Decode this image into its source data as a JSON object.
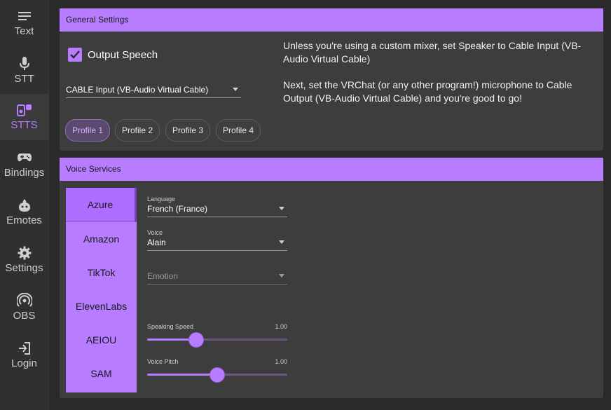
{
  "sidebar": {
    "items": [
      {
        "label": "Text",
        "icon": "menu-lines-icon"
      },
      {
        "label": "STT",
        "icon": "microphone-icon"
      },
      {
        "label": "STTS",
        "icon": "speaker-icon"
      },
      {
        "label": "Bindings",
        "icon": "gamepad-icon"
      },
      {
        "label": "Emotes",
        "icon": "emote-icon"
      },
      {
        "label": "Settings",
        "icon": "gear-icon"
      },
      {
        "label": "OBS",
        "icon": "broadcast-icon"
      },
      {
        "label": "Login",
        "icon": "login-icon"
      }
    ],
    "active": "STTS"
  },
  "general": {
    "title": "General Settings",
    "output_speech_label": "Output Speech",
    "output_speech_checked": true,
    "speaker_value": "CABLE Input (VB-Audio Virtual Cable)",
    "help_1": "Unless you're using a custom mixer, set Speaker to Cable Input (VB-Audio Virtual Cable)",
    "help_2": "Next, set the VRChat (or any other program!) microphone to Cable Output (VB-Audio Virtual Cable) and you're good to go!",
    "profiles": [
      "Profile 1",
      "Profile 2",
      "Profile 3",
      "Profile 4"
    ],
    "active_profile": "Profile 1"
  },
  "voice": {
    "title": "Voice Services",
    "services": [
      "Azure",
      "Amazon",
      "TikTok",
      "ElevenLabs",
      "AEIOU",
      "SAM"
    ],
    "active_service": "Azure",
    "language_label": "Language",
    "language_value": "French (France)",
    "voice_label": "Voice",
    "voice_value": "Alain",
    "emotion_placeholder": "Emotion",
    "speed_label": "Speaking Speed",
    "speed_value_text": "1.00",
    "speed_fraction": 0.35,
    "pitch_label": "Voice Pitch",
    "pitch_value_text": "1.00",
    "pitch_fraction": 0.5
  },
  "colors": {
    "accent": "#b77cff",
    "background": "#2a2a2a",
    "panel": "#3d3d3d"
  }
}
